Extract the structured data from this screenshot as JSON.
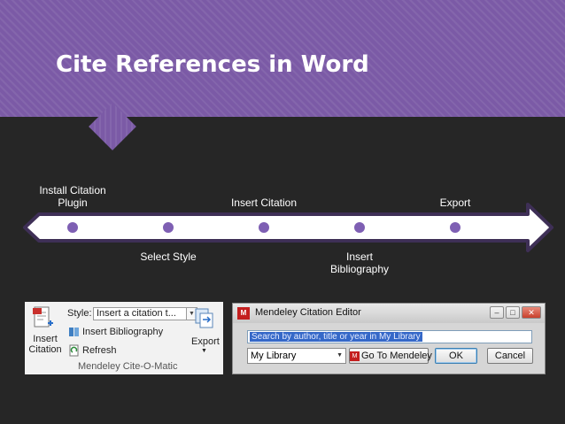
{
  "slide": {
    "title": "Cite References in Word"
  },
  "timeline": {
    "above_steps": [
      {
        "line1": "Install Citation",
        "line2": "Plugin"
      },
      {
        "line1": "Insert Citation"
      },
      {
        "line1": "Export"
      }
    ],
    "below_steps": [
      {
        "line1": "Select Style"
      },
      {
        "line1": "Insert",
        "line2": "Bibliography"
      }
    ]
  },
  "word_ribbon": {
    "insert_citation_label_1": "Insert",
    "insert_citation_label_2": "Citation",
    "style_label": "Style:",
    "style_value": "Insert a citation t...",
    "insert_bibliography": "Insert Bibliography",
    "refresh": "Refresh",
    "export": "Export",
    "group_label": "Mendeley Cite-O-Matic"
  },
  "citation_dialog": {
    "logo_text": "M",
    "title": "Mendeley Citation Editor",
    "minimize": "–",
    "maximize": "□",
    "close": "✕",
    "search_text": "Search by author, title or year in My Library",
    "library_value": "My Library",
    "goto_logo": "M",
    "goto_label": "Go To Mendeley",
    "ok_label": "OK",
    "cancel_label": "Cancel"
  }
}
